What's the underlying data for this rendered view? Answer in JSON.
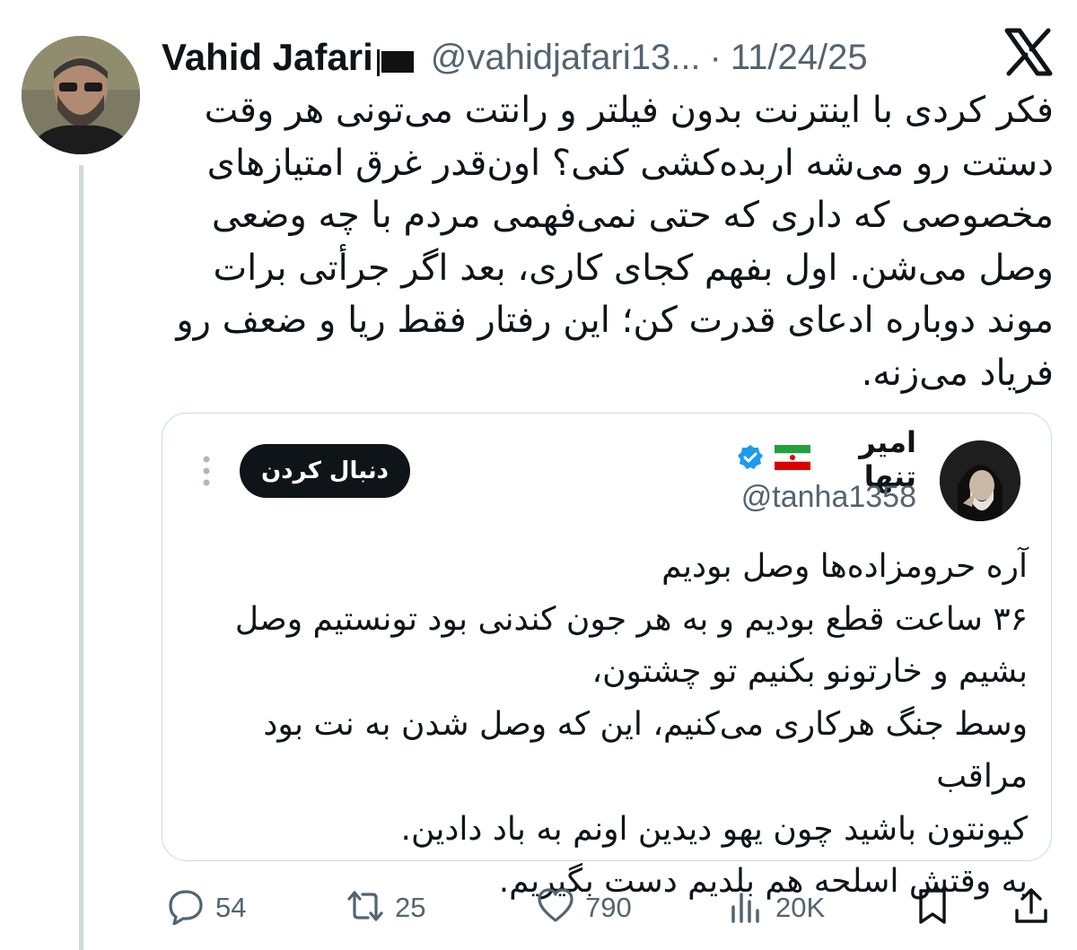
{
  "tweet": {
    "author_name": "Vahid Jafari",
    "author_handle": "@vahidjafari13...",
    "separator": "·",
    "date": "11/24/25",
    "text": "فکر کردی با اینترنت بدون فیلتر و رانتت می‌تونی هر وقت\nدستت رو می‌شه اربده‌کشی کنی؟ اون‌قدر غرق امتیازهای\nمخصوصی که داری که حتی نمی‌فهمی مردم با چه وضعی\nوصل می‌شن. اول بفهم کجای کاری، بعد اگر جرأتی برات\nموند دوباره ادعای قدرت کن؛ این رفتار فقط ریا و ضعف رو\nفریاد می‌زنه."
  },
  "quote": {
    "name": "امیر تنها",
    "handle": "@tanha1358",
    "follow_label": "دنبال کردن",
    "text": "آره حرومزاده‌ها وصل بودیم\n۳۶ ساعت قطع بودیم و به هر جون کندنی بود تونستیم وصل\nبشیم و خارتونو بکنیم تو چشتون،\nوسط جنگ هرکاری می‌کنیم، این که وصل شدن به نت بود مراقب\nکیونتون باشید چون یهو دیدین اونم به باد دادین.\nبه وقتش اسلحه هم بلدیم دست بگیریم."
  },
  "actions": {
    "replies": "54",
    "reposts": "25",
    "likes": "790",
    "views": "20K"
  },
  "icons": {
    "platform_logo": "x-logo",
    "reply": "reply-icon",
    "repost": "repost-icon",
    "like": "heart-icon",
    "views": "views-icon",
    "bookmark": "bookmark-icon",
    "share": "share-icon",
    "verified": "verified-badge-icon",
    "flag_iran": "iran-flag-icon",
    "flag_black": "black-flag-icon"
  },
  "colors": {
    "text": "#0f1419",
    "secondary": "#536471",
    "border": "#cfd9de",
    "verified": "#1d9bf0"
  }
}
